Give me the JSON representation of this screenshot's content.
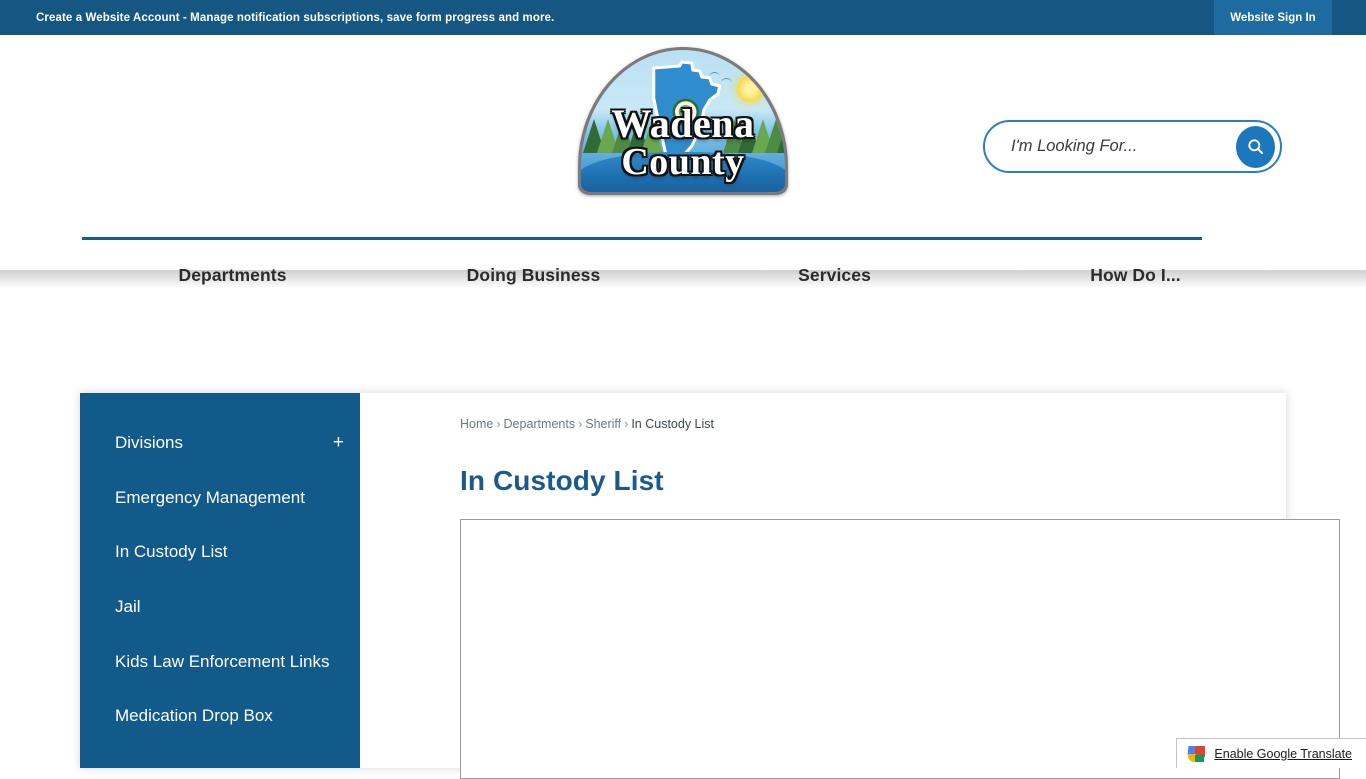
{
  "topbar": {
    "account_bold": "Create a Website Account",
    "account_rest": " - Manage notification subscriptions, save form progress and more.",
    "signin_label": "Website Sign In",
    "bg_color": "#165683",
    "signin_bg_color": "#1d6ba0"
  },
  "logo": {
    "line1": "Wadena",
    "line2": "County",
    "alt": "Wadena County Minnesota seal"
  },
  "search": {
    "placeholder": "I'm Looking For...",
    "value": "",
    "button_icon": "search-icon",
    "accent_color": "#1c77bd"
  },
  "nav": {
    "items": [
      {
        "label": "Departments"
      },
      {
        "label": "Doing Business"
      },
      {
        "label": "Services"
      },
      {
        "label": "How Do I..."
      }
    ]
  },
  "sidebar": {
    "bg_color": "#115A8A",
    "items": [
      {
        "label": "Divisions",
        "expander": "+"
      },
      {
        "label": "Emergency Management"
      },
      {
        "label": "In Custody List"
      },
      {
        "label": "Jail"
      },
      {
        "label": "Kids Law Enforcement Links"
      },
      {
        "label": "Medication Drop Box"
      }
    ]
  },
  "breadcrumb": {
    "items": [
      {
        "label": "Home"
      },
      {
        "label": "Departments"
      },
      {
        "label": "Sheriff"
      },
      {
        "label": "In Custody List"
      }
    ],
    "separator": "›"
  },
  "main": {
    "title": "In Custody List",
    "title_color": "#1b5b8a",
    "frame_content": ""
  },
  "translate": {
    "label": "Enable Google Translate",
    "icon": "google-translate-icon"
  }
}
